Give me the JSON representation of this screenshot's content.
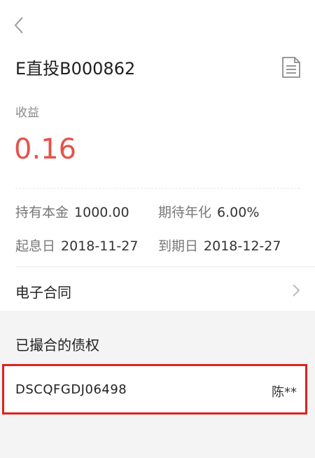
{
  "header": {
    "title": "E直投B000862"
  },
  "income": {
    "label": "收益",
    "value": "0.16"
  },
  "details": {
    "principal": {
      "label": "持有本金",
      "value": "1000.00"
    },
    "annual_rate": {
      "label": "期待年化",
      "value": "6.00%"
    },
    "start_date": {
      "label": "起息日",
      "value": "2018-11-27"
    },
    "due_date": {
      "label": "到期日",
      "value": "2018-12-27"
    }
  },
  "contract": {
    "label": "电子合同"
  },
  "matched": {
    "title": "已撮合的债权",
    "items": [
      {
        "code": "DSCQFGDJ06498",
        "name": "陈**"
      }
    ]
  },
  "icons": {
    "back": "chevron-left-icon",
    "document": "document-icon",
    "chevron": "chevron-right-icon"
  },
  "colors": {
    "accent_red": "#e5524c",
    "highlight_border": "#e0221c"
  }
}
